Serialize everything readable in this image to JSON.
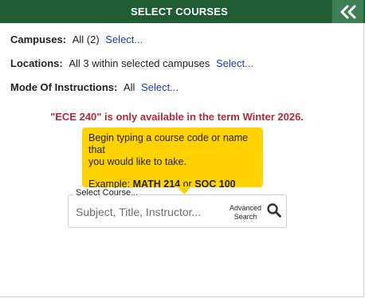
{
  "header": {
    "title": "SELECT COURSES",
    "collapse_icon": "double-chevron-left-icon"
  },
  "filters": {
    "campuses": {
      "label": "Campuses:",
      "value": "All (2)",
      "link": "Select..."
    },
    "locations": {
      "label": "Locations:",
      "value": "All 3 within selected campuses",
      "link": "Select..."
    },
    "mode": {
      "label": "Mode Of Instructions:",
      "value": "All",
      "link": "Select..."
    }
  },
  "alert": "\"ECE 240\" is only available in the term Winter 2026.",
  "tooltip": {
    "line1": "Begin typing a course code or name that",
    "line2": "you would like to take.",
    "example_prefix": "Example:",
    "example1": "MATH 214",
    "example_or": "or",
    "example2": "SOC 100"
  },
  "search": {
    "label": "Select Course...",
    "placeholder": "Subject, Title, Instructor...",
    "value": "",
    "advanced_line1": "Advanced",
    "advanced_line2": "Search",
    "icon": "search-icon"
  },
  "colors": {
    "header_bg": "#1f5c33",
    "alert": "#b12a39",
    "link": "#1a3fa8",
    "tooltip_bg": "#ffd200"
  }
}
